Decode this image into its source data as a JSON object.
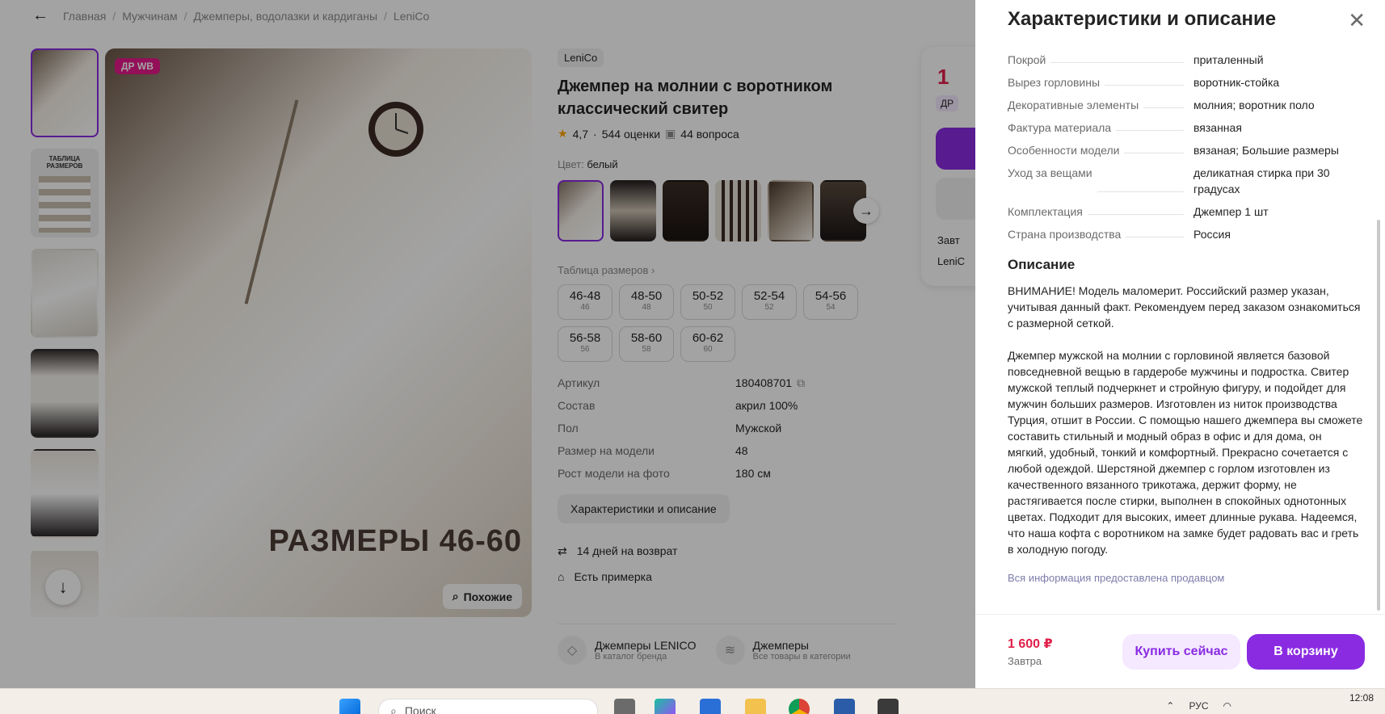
{
  "breadcrumbs": [
    "Главная",
    "Мужчинам",
    "Джемперы, водолазки и кардиганы",
    "LeniCo"
  ],
  "gallery": {
    "badge": "ДР WB",
    "overlay_text": "РАЗМЕРЫ 46-60",
    "similar_button": "Похожие",
    "thumb_label_table": "ТАБЛИЦА РАЗМЕРОВ"
  },
  "product": {
    "brand": "LeniCo",
    "title": "Джемпер на молнии с воротником классический свитер",
    "rating": "4,7",
    "reviews": "544 оценки",
    "questions": "44 вопроса",
    "color_label": "Цвет:",
    "color_value": "белый",
    "size_table_link": "Таблица размеров",
    "sizes": [
      {
        "main": "46-48",
        "sub": "46"
      },
      {
        "main": "48-50",
        "sub": "48"
      },
      {
        "main": "50-52",
        "sub": "50"
      },
      {
        "main": "52-54",
        "sub": "52"
      },
      {
        "main": "54-56",
        "sub": "54"
      },
      {
        "main": "56-58",
        "sub": "56"
      },
      {
        "main": "58-60",
        "sub": "58"
      },
      {
        "main": "60-62",
        "sub": "60"
      }
    ],
    "params": [
      {
        "k": "Артикул",
        "v": "180408701"
      },
      {
        "k": "Состав",
        "v": "акрил 100%"
      },
      {
        "k": "Пол",
        "v": "Мужской"
      },
      {
        "k": "Размер на модели",
        "v": "48"
      },
      {
        "k": "Рост модели на фото",
        "v": "180 см"
      }
    ],
    "chars_button": "Характеристики и описание",
    "perk_return": "14 дней на возврат",
    "perk_fitting": "Есть примерка",
    "brand_link_title": "Джемперы LENICO",
    "brand_link_sub": "В каталог бренда",
    "category_link_title": "Джемперы",
    "category_link_sub": "Все товары в категории"
  },
  "buy_card": {
    "price_partial": "1",
    "dr_partial": "ДР",
    "line1": "Завт",
    "line2": "LeniC"
  },
  "panel": {
    "title": "Характеристики и описание",
    "characteristics": [
      {
        "k": "Покрой",
        "v": "приталенный"
      },
      {
        "k": "Вырез горловины",
        "v": "воротник-стойка"
      },
      {
        "k": "Декоративные элементы",
        "v": "молния; воротник поло"
      },
      {
        "k": "Фактура материала",
        "v": "вязанная"
      },
      {
        "k": "Особенности модели",
        "v": "вязаная; Большие размеры"
      },
      {
        "k": "Уход за вещами",
        "v": "деликатная стирка при 30 градусах"
      },
      {
        "k": "Комплектация",
        "v": "Джемпер 1 шт"
      },
      {
        "k": "Страна производства",
        "v": "Россия"
      }
    ],
    "description_title": "Описание",
    "description_p1": "ВНИМАНИЕ! Модель маломерит. Российский размер указан, учитывая данный факт. Рекомендуем перед заказом ознакомиться с размерной сеткой.",
    "description_p2": "Джемпер мужской на молнии с горловиной является базовой повседневной вещью в гардеробе мужчины и подростка. Свитер мужской теплый подчеркнет и стройную фигуру, и подойдет для мужчин больших размеров. Изготовлен из ниток производства Турция, отшит в России. С помощью нашего джемпера вы сможете составить стильный и модный образ в офис и для дома, он мягкий, удобный, тонкий и комфортный. Прекрасно сочетается с любой одеждой. Шерстяной джемпер с горлом изготовлен из качественного вязанного трикотажа, держит форму, не растягивается после стирки, выполнен в спокойных однотонных цветах. Подходит для высоких, имеет длинные рукава. Надеемся, что наша кофта с воротником на замке будет радовать вас и греть в холодную погоду.",
    "seller_note": "Вся информация предоставлена продавцом",
    "footer_price": "1 600 ₽",
    "footer_when": "Завтра",
    "buy_now": "Купить сейчас",
    "to_cart": "В корзину"
  },
  "taskbar": {
    "search_placeholder": "Поиск",
    "lang": "РУС",
    "time": "12:08"
  },
  "colors": {
    "accent": "#8a2be2",
    "price": "#e0204a",
    "badge": "#e6198c"
  }
}
